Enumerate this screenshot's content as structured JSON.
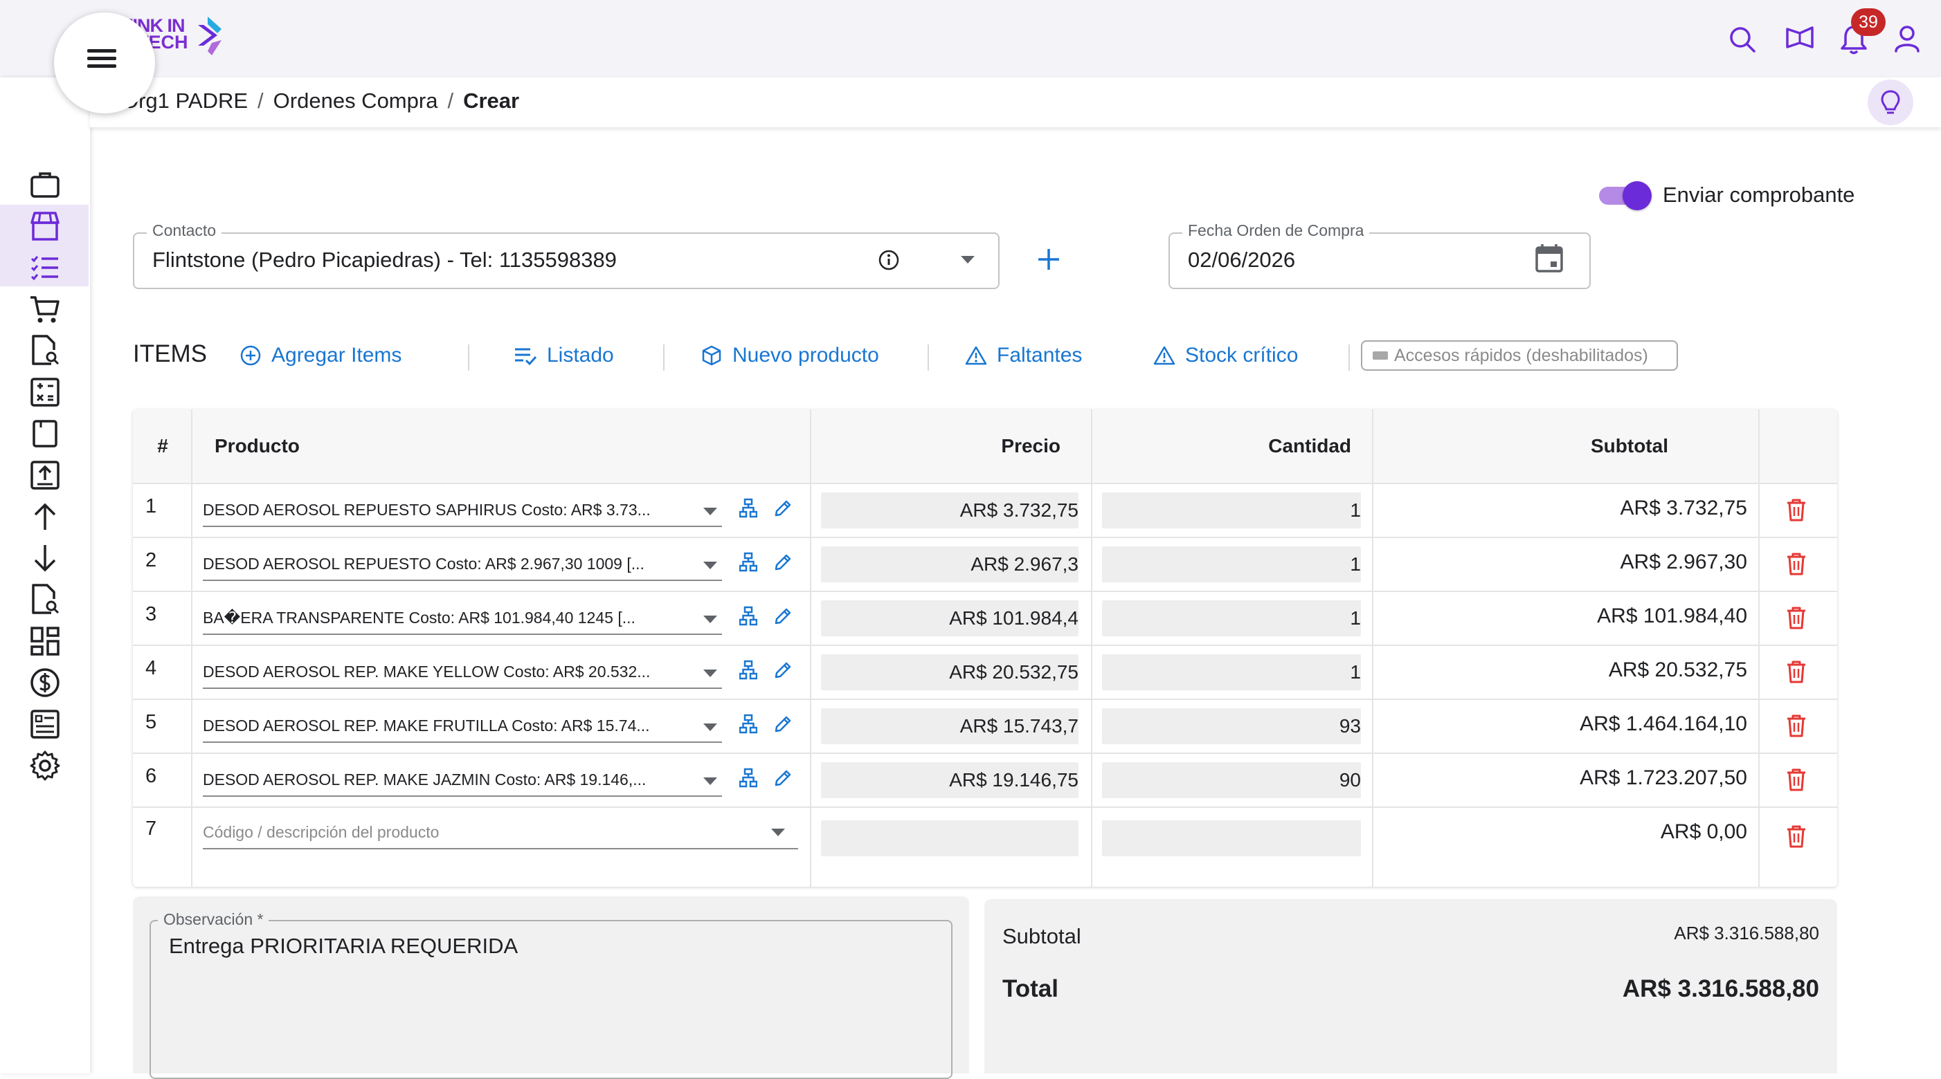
{
  "header": {
    "logo_line1": "ZINK IN",
    "logo_line2": "TECH",
    "notifications_count": "39"
  },
  "breadcrumb": {
    "items": [
      "Org1 PADRE",
      "Ordenes Compra",
      "Crear"
    ],
    "separator": "/"
  },
  "form": {
    "send_toggle_label": "Enviar comprobante",
    "send_toggle_on": true,
    "contact_label": "Contacto",
    "contact_value": "Flintstone (Pedro Picapiedras) - Tel: 1135598389",
    "date_label": "Fecha Orden de Compra",
    "date_value": "02/06/2026"
  },
  "items_toolbar": {
    "title": "ITEMS",
    "add_items": "Agregar Items",
    "listado": "Listado",
    "nuevo_producto": "Nuevo producto",
    "faltantes": "Faltantes",
    "stock_critico": "Stock crítico",
    "accesos": "Accesos rápidos (deshabilitados)"
  },
  "table": {
    "headers": {
      "num": "#",
      "producto": "Producto",
      "precio": "Precio",
      "cantidad": "Cantidad",
      "subtotal": "Subtotal"
    },
    "rows": [
      {
        "num": "1",
        "producto": "DESOD AEROSOL REPUESTO SAPHIRUS Costo: AR$ 3.73...",
        "precio": "AR$ 3.732,75",
        "cantidad": "1",
        "subtotal": "AR$ 3.732,75"
      },
      {
        "num": "2",
        "producto": "DESOD AEROSOL REPUESTO Costo: AR$ 2.967,30 1009 [...",
        "precio": "AR$ 2.967,3",
        "cantidad": "1",
        "subtotal": "AR$ 2.967,30"
      },
      {
        "num": "3",
        "producto": "BA�ERA TRANSPARENTE  Costo: AR$ 101.984,40 1245 [...",
        "precio": "AR$ 101.984,4",
        "cantidad": "1",
        "subtotal": "AR$ 101.984,40"
      },
      {
        "num": "4",
        "producto": "DESOD AEROSOL REP. MAKE YELLOW Costo: AR$ 20.532...",
        "precio": "AR$ 20.532,75",
        "cantidad": "1",
        "subtotal": "AR$ 20.532,75"
      },
      {
        "num": "5",
        "producto": "DESOD AEROSOL REP. MAKE FRUTILLA Costo: AR$ 15.74...",
        "precio": "AR$ 15.743,7",
        "cantidad": "93",
        "subtotal": "AR$ 1.464.164,10"
      },
      {
        "num": "6",
        "producto": "DESOD AEROSOL REP. MAKE JAZMIN Costo: AR$ 19.146,...",
        "precio": "AR$ 19.146,75",
        "cantidad": "90",
        "subtotal": "AR$ 1.723.207,50"
      }
    ],
    "new_row": {
      "num": "7",
      "placeholder": "Código / descripción del producto",
      "subtotal": "AR$ 0,00"
    }
  },
  "observacion": {
    "label": "Observación *",
    "value": "Entrega PRIORITARIA REQUERIDA"
  },
  "totals": {
    "subtotal_label": "Subtotal",
    "subtotal_value": "AR$ 3.316.588,80",
    "total_label": "Total",
    "total_value": "AR$ 3.316.588,80"
  },
  "colors": {
    "accent_purple": "#6c2bd9",
    "link_blue": "#1976d2",
    "delete_red": "#e53935",
    "badge_red": "#c62828"
  },
  "sidebar_icons": [
    "briefcase-icon",
    "store-icon",
    "checklist-icon",
    "cart-icon",
    "doc-search-icon",
    "calculator-icon",
    "book-icon",
    "upload-icon",
    "arrow-up-icon",
    "arrow-down-icon",
    "doc-search-icon-2",
    "dashboard-icon",
    "dollar-icon",
    "report-icon",
    "settings-icon"
  ]
}
